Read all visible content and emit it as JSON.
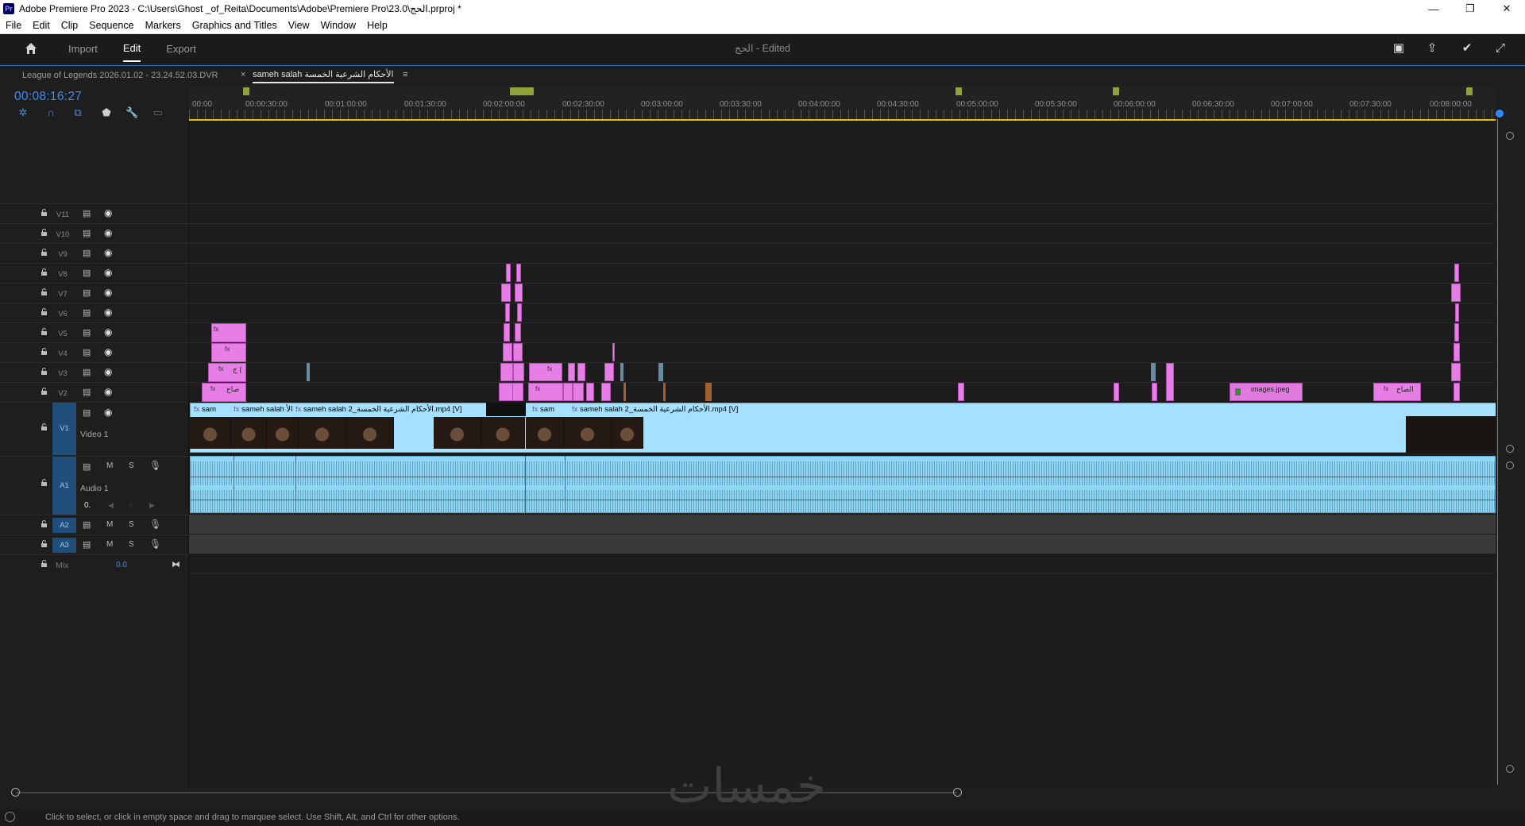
{
  "window": {
    "title": "Adobe Premiere Pro 2023 - C:\\Users\\Ghost _of_Reita\\Documents\\Adobe\\Premiere Pro\\23.0\\الحج.prproj *",
    "logo": "Pr",
    "minimize": "—",
    "restore": "❐",
    "close": "✕"
  },
  "menu": [
    "File",
    "Edit",
    "Clip",
    "Sequence",
    "Markers",
    "Graphics and Titles",
    "View",
    "Window",
    "Help"
  ],
  "header": {
    "tabs": [
      "Import",
      "Edit",
      "Export"
    ],
    "active_tab": "Edit",
    "project_status": "الحج - Edited"
  },
  "sequence_tabs": {
    "inactive": "League of Legends 2026.01.02 - 23.24.52.03.DVR",
    "active": "sameh salah الأحكام الشرعية الخمسة",
    "close": "×",
    "menu": "≡"
  },
  "timecode": "00:08:16:27",
  "ruler_labels": [
    "00:00",
    "00:00:30:00",
    "00:01:00:00",
    "00:01:30:00",
    "00:02:00:00",
    "00:02:30:00",
    "00:03:00:00",
    "00:03:30:00",
    "00:04:00:00",
    "00:04:30:00",
    "00:05:00:00",
    "00:05:30:00",
    "00:06:00:00",
    "00:06:30:00",
    "00:07:00:00",
    "00:07:30:00",
    "00:08:00:00"
  ],
  "video_tracks": [
    "V11",
    "V10",
    "V9",
    "V8",
    "V7",
    "V6",
    "V5",
    "V4",
    "V3",
    "V2"
  ],
  "v1": {
    "label": "V1",
    "name": "Video 1"
  },
  "a1": {
    "label": "A1",
    "name": "Audio 1",
    "vol": "0."
  },
  "audio_tracks": [
    "A2",
    "A3"
  ],
  "mix": {
    "label": "Mix",
    "value": "0.0"
  },
  "clips": {
    "v1_sam_1": "sam",
    "v1_sameh_1": "sameh salah الأ",
    "v1_main_1": "sameh salah 2_الأحكام الشرعية الخمسة.mp4 [V]",
    "v1_sam_2": "sam",
    "v1_main_2": "sameh salah 2_الأحكام الشرعية الخمسة.mp4 [V]",
    "v2_img": "images.jpeg",
    "v2_late": "الصاح",
    "v2_early": "صاح",
    "v3_early": "ج (",
    "fx": "fx"
  },
  "status": "Click to select, or click in empty space and drag to marquee select. Use Shift, Alt, and Ctrl for other options.",
  "watermark": "خمسات",
  "icons": {
    "home": "home-icon",
    "quick_export": "share-icon",
    "publish": "checkmark-icon",
    "fullscreen": "fullscreen-icon"
  }
}
